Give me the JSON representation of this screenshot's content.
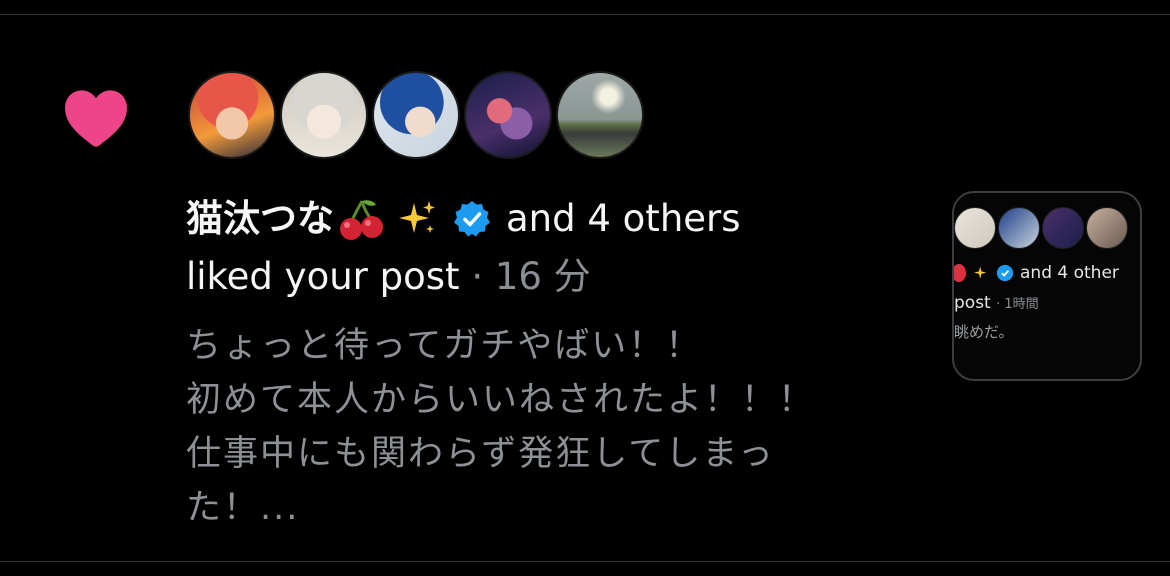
{
  "notification": {
    "icon": "heart-icon",
    "heart_color": "#ee4588",
    "avatars": [
      "avatar-1",
      "avatar-2",
      "avatar-3",
      "avatar-4",
      "avatar-5"
    ],
    "username": "猫汰つな",
    "username_emojis": [
      "cherry-icon",
      "sparkles-icon"
    ],
    "verified": true,
    "verified_color": "#1d9bf0",
    "and_others": "and 4 others",
    "action": "liked your post",
    "separator": "·",
    "time": "16 分",
    "preview_text": "ちょっと待ってガチやばい！！\n初めて本人からいいねされたよ！！！\n仕事中にも関わらず発狂してしまっ\nた！..."
  },
  "thumbnail": {
    "line1_text": "and 4 other",
    "line2_text": "post",
    "line2_time": "· 1時間",
    "line3_text": "眺めだ。"
  }
}
